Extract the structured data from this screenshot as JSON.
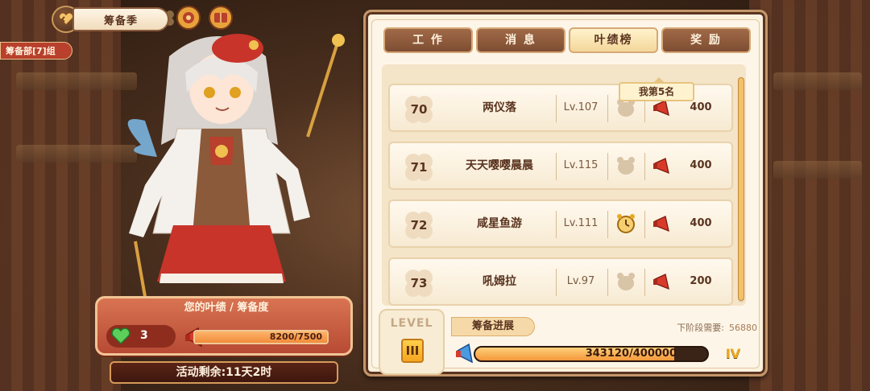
{
  "header": {
    "title": "筹备季",
    "badge": "筹备部[7]组"
  },
  "stats": {
    "title": "您的叶绩 / 筹备度",
    "hearts": "3",
    "progress_text": "8200/7500",
    "progress_fraction": 1.0,
    "timer": "活动剩余:11天2时"
  },
  "tabs": [
    {
      "label": "工 作",
      "active": false
    },
    {
      "label": "消 息",
      "active": false
    },
    {
      "label": "叶绩榜",
      "active": true
    },
    {
      "label": "奖 励",
      "active": false
    }
  ],
  "my_rank_label": "我第5名",
  "leaderboard": [
    {
      "rank": "70",
      "name": "两仪落",
      "level": "Lv.107",
      "icon": "bear-icon",
      "score": "400"
    },
    {
      "rank": "71",
      "name": "天天嘤嘤晨晨",
      "level": "Lv.115",
      "icon": "bear-icon",
      "score": "400"
    },
    {
      "rank": "72",
      "name": "咸星鱼游",
      "level": "Lv.111",
      "icon": "alarm-clock-icon",
      "score": "400"
    },
    {
      "rank": "73",
      "name": "吼姆拉",
      "level": "Lv.97",
      "icon": "bear-icon",
      "score": "200"
    }
  ],
  "progress": {
    "level_word": "LEVEL",
    "level": "III",
    "label": "筹备进展",
    "need_label": "下阶段需要:",
    "need_value": "56880",
    "value_text": "343120/400000",
    "fraction": 0.8578,
    "next_level": "IV"
  },
  "colors": {
    "accent": "#f3973a",
    "panel": "#fbf1de",
    "brown": "#5a3420",
    "red": "#b74a34"
  }
}
